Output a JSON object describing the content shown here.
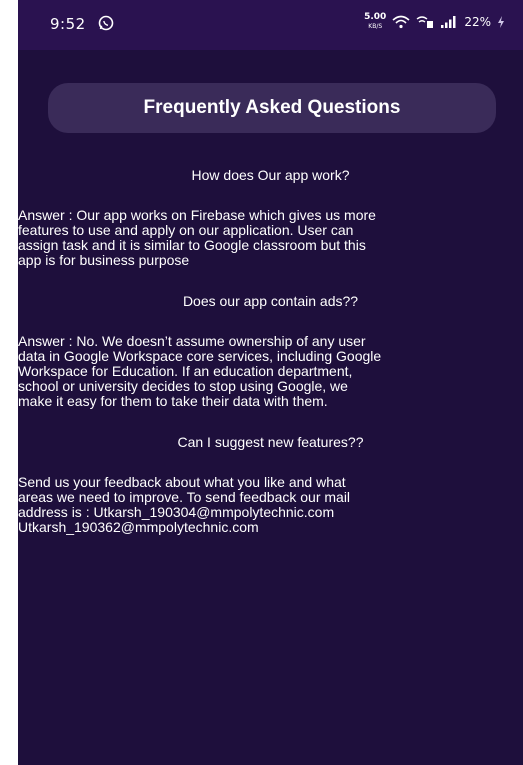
{
  "status_bar": {
    "time": "9:52",
    "net_speed_value": "5.00",
    "net_speed_unit": "KB/S",
    "battery": "22%",
    "icons": [
      "whatsapp-icon",
      "wifi-icon",
      "volte-icon",
      "signal-icon",
      "bolt-icon"
    ]
  },
  "header": {
    "title": "Frequently Asked Questions"
  },
  "faq": {
    "items": [
      {
        "question": "How does Our app work?",
        "answer_lines": [
          "Answer :  Our app works on Firebase which gives us  more",
          "features to use and apply on our application. User can",
          "assign task and it is similar to Google classroom but this",
          "app is for business purpose"
        ]
      },
      {
        "question": "Does our app contain ads??",
        "answer_lines": [
          "Answer : No. We doesn’t assume ownership of any user",
          "data in Google Workspace core services, including Google",
          "Workspace for Education. If an education department,",
          "school or university decides to stop using Google, we",
          "make it easy for them to take their data with them."
        ]
      },
      {
        "question": "Can I suggest new features??",
        "answer_lines": [
          "Send us your feedback about what you like and what",
          "areas we need to improve. To send feedback our mail",
          "address is : Utkarsh_190304@mmpolytechnic.com",
          "Utkarsh_190362@mmpolytechnic.com"
        ]
      }
    ]
  },
  "colors": {
    "background": "#1e0f3c",
    "status_bar": "#2a1250",
    "title_pill": "#3a2b59",
    "text": "#ffffff"
  }
}
